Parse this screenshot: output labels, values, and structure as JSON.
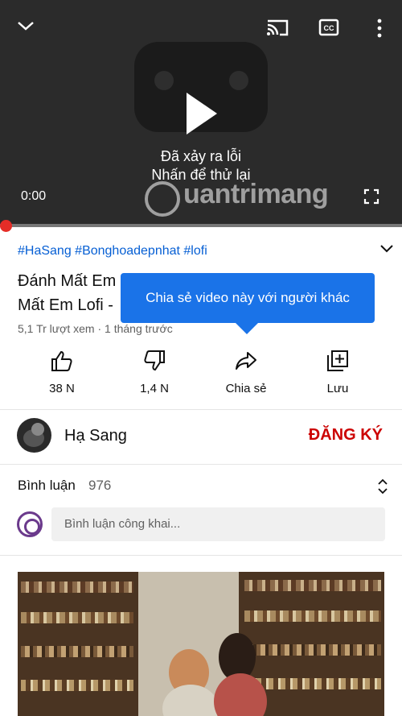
{
  "player": {
    "error_title": "Đã xảy ra lỗi",
    "error_subtitle": "Nhấn để thử lại",
    "current_time": "0:00",
    "watermark": "uantrimang"
  },
  "video": {
    "hashtags": "#HaSang #Bonghoadepnhat #lofi",
    "title_line1": "Đánh Mất Em",
    "title_line2": "Mất Em Lofi -",
    "views": "5,1 Tr lượt xem · 1 tháng trước"
  },
  "tooltip": {
    "text": "Chia sẻ video này với người khác"
  },
  "actions": {
    "like": "38 N",
    "dislike": "1,4 N",
    "share": "Chia sẻ",
    "save": "Lưu"
  },
  "channel": {
    "name": "Hạ Sang",
    "subscribe": "ĐĂNG KÝ"
  },
  "comments": {
    "heading": "Bình luận",
    "count": "976",
    "placeholder": "Bình luận công khai..."
  },
  "colors": {
    "accent_red": "#cc0000",
    "tooltip_blue": "#1a73e8",
    "hashtag_blue": "#065fd4"
  },
  "icons": [
    "chevron-down-icon",
    "cast-icon",
    "captions-icon",
    "more-vert-icon",
    "play-icon",
    "fullscreen-icon",
    "expand-description-icon",
    "like-icon",
    "dislike-icon",
    "share-icon",
    "save-playlist-icon",
    "sort-icon"
  ]
}
